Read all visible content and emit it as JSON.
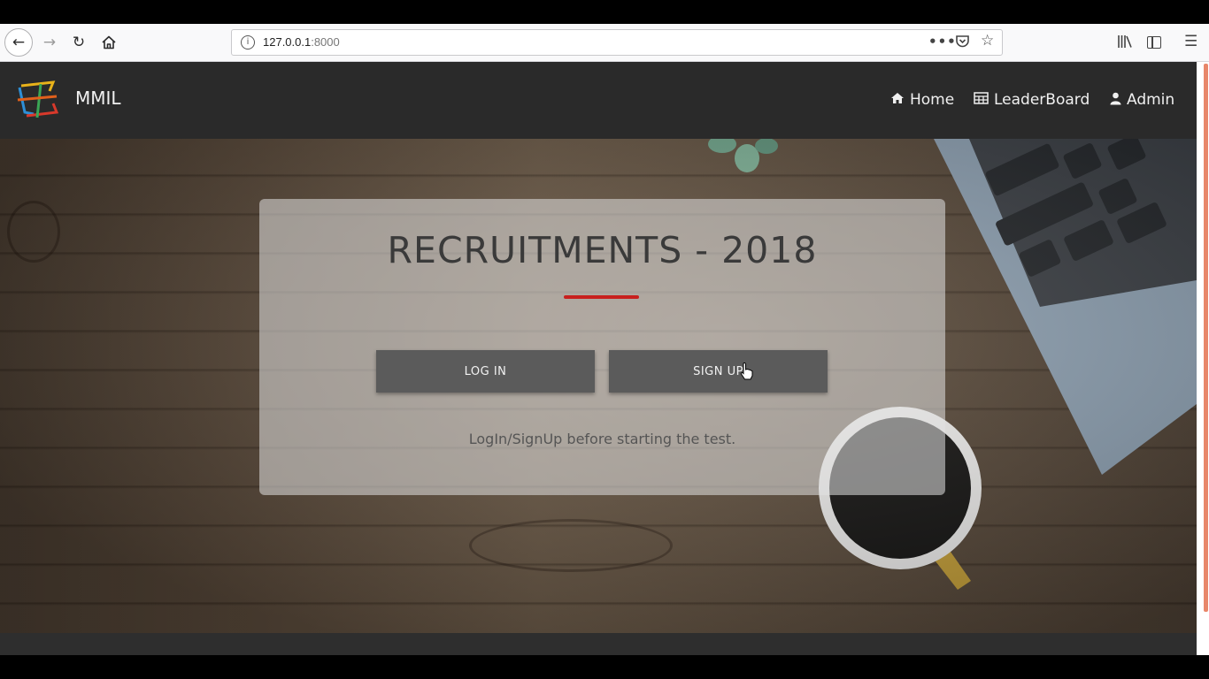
{
  "browser": {
    "url_host": "127.0.0.1",
    "url_port": ":8000",
    "icons": {
      "back": "back-arrow-icon",
      "forward": "forward-arrow-icon",
      "reload": "reload-icon",
      "home": "home-icon",
      "page_info": "info-icon",
      "more": "more-dots-icon",
      "pocket": "pocket-icon",
      "bookmark": "star-icon",
      "library": "library-icon",
      "sidebar": "sidebar-icon",
      "menu": "hamburger-menu-icon"
    }
  },
  "navbar": {
    "brand": "MMIL",
    "items": [
      {
        "label": "Home",
        "icon": "home-icon"
      },
      {
        "label": "LeaderBoard",
        "icon": "table-icon"
      },
      {
        "label": "Admin",
        "icon": "user-icon"
      }
    ]
  },
  "card": {
    "title": "RECRUITMENTS - 2018",
    "login_label": "LOG IN",
    "signup_label": "SIGN UP",
    "note": "LogIn/SignUp before starting the test."
  },
  "colors": {
    "navbar_bg": "#2a2a2a",
    "accent_rule": "#c8201e",
    "button_bg": "#5b5b5b",
    "scrollbar": "#e8876a"
  }
}
